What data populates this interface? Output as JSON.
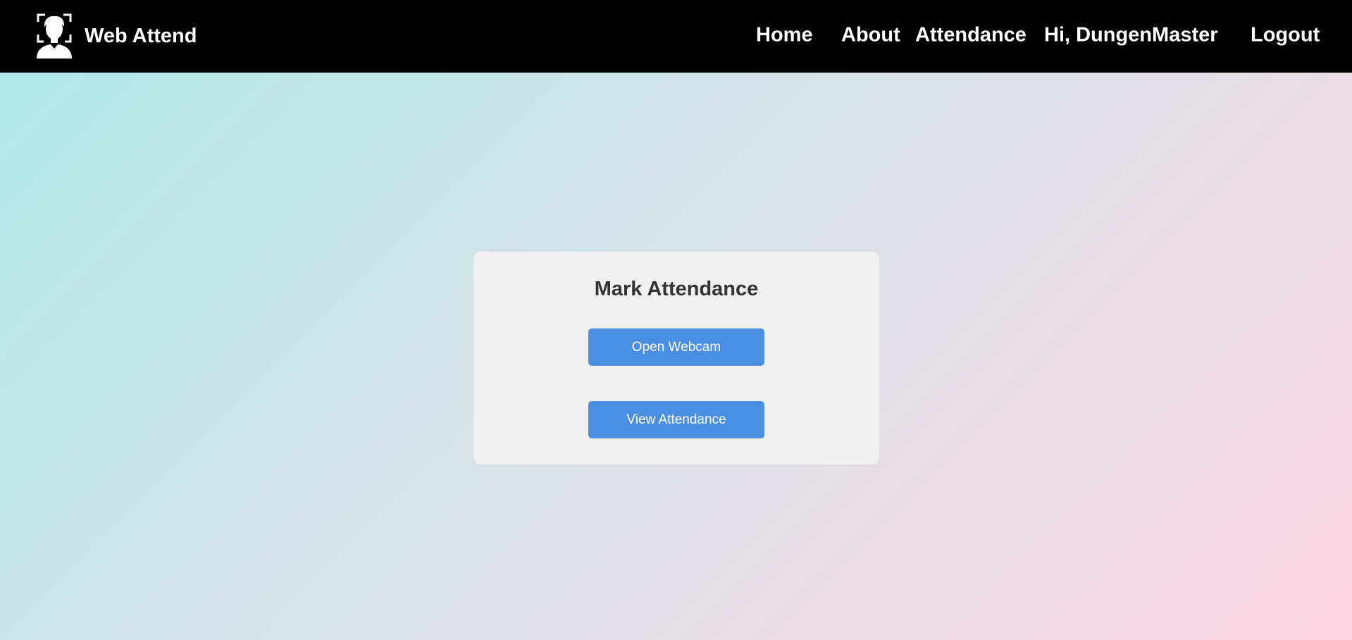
{
  "navbar": {
    "brand": {
      "title": "Web Attend",
      "icon": "face-scan-user-icon"
    },
    "links": {
      "home": "Home",
      "about": "About",
      "attendance": "Attendance",
      "user_greeting": "Hi, DungenMaster",
      "logout": "Logout"
    },
    "background_color": "#000000",
    "text_color": "#ffffff"
  },
  "card": {
    "title": "Mark Attendance",
    "buttons": {
      "open_webcam": "Open Webcam",
      "view_attendance": "View Attendance"
    },
    "button_color": "#4a8fe2",
    "background_color": "#f0f0f0"
  },
  "page": {
    "background_gradient": [
      "#aeeaea",
      "#d9e1e6",
      "#fcd6e3"
    ]
  }
}
